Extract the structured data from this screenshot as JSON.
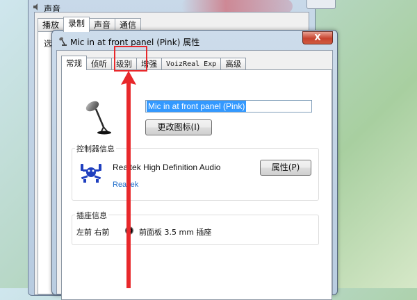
{
  "background_window": {
    "title": "声音",
    "tabs": [
      "播放",
      "录制",
      "声音",
      "通信"
    ],
    "active_tab_index": 1,
    "panel_hint": "选"
  },
  "dialog": {
    "title": "Mic in at front panel (Pink) 属性",
    "close_label": "X",
    "tabs": [
      "常规",
      "侦听",
      "级别",
      "增强",
      "VoizReal Exp",
      "高级"
    ],
    "active_tab_index": 0,
    "device_name": "Mic in at front panel (Pink)",
    "change_icon_label": "更改图标(I)",
    "controller_group": {
      "legend": "控制器信息",
      "name": "Realtek High Definition Audio",
      "vendor_link": "Realtek",
      "properties_label": "属性(P)"
    },
    "jack_group": {
      "legend": "插座信息",
      "location": "左前 右前",
      "jack_text": "前面板 3.5 mm 插座",
      "jack_color": "#e04080"
    }
  },
  "annotation": {
    "highlight_color": "#e8282b",
    "highlighted_tab": "级别"
  }
}
